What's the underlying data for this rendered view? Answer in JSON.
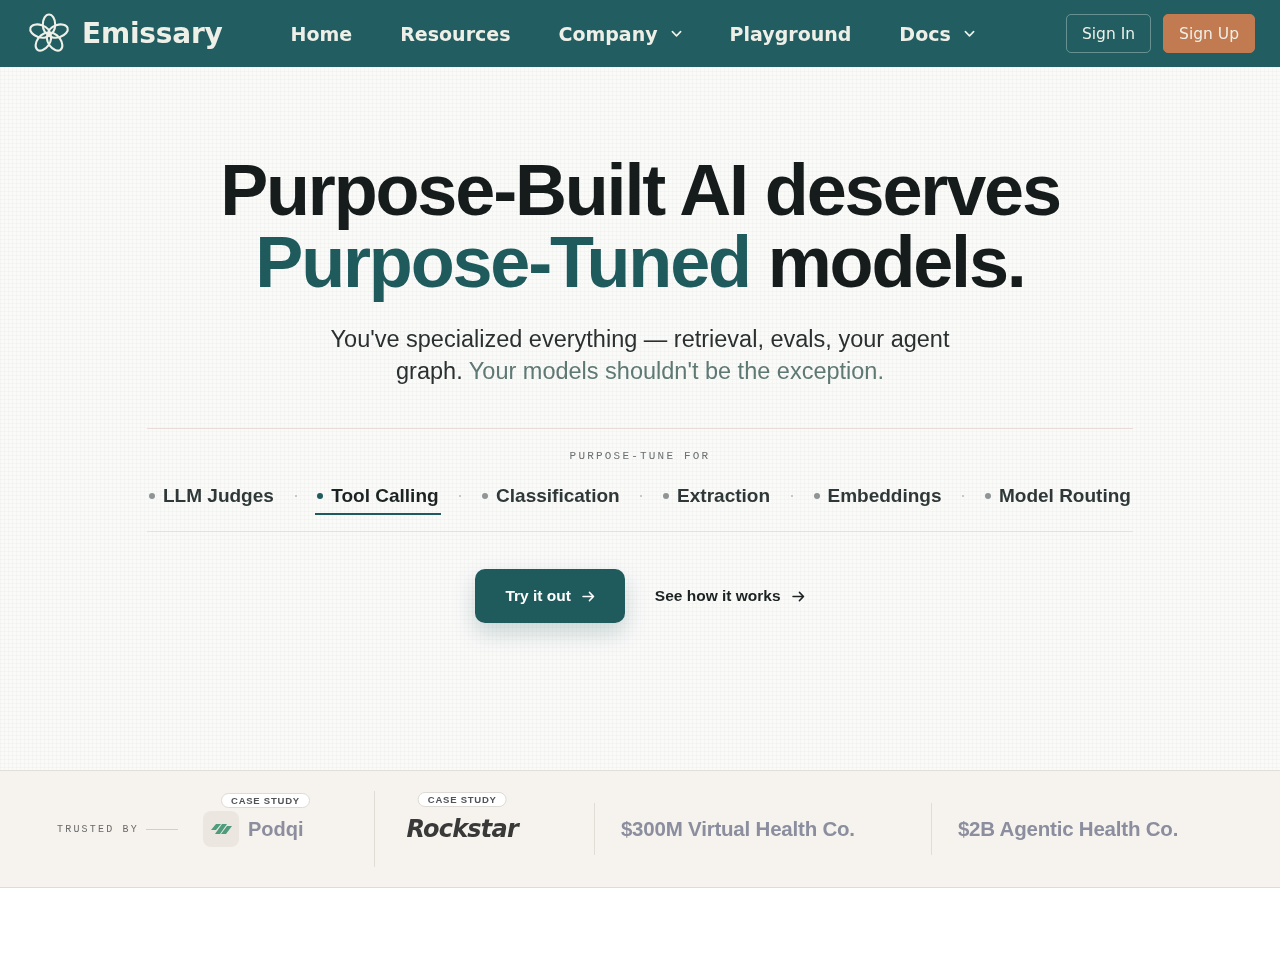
{
  "nav": {
    "brand": "Emissary",
    "links": [
      {
        "label": "Home",
        "has_menu": false
      },
      {
        "label": "Resources",
        "has_menu": false
      },
      {
        "label": "Company",
        "has_menu": true
      },
      {
        "label": "Playground",
        "has_menu": false
      },
      {
        "label": "Docs",
        "has_menu": true
      }
    ],
    "sign_in": "Sign In",
    "sign_up": "Sign Up"
  },
  "hero": {
    "heading": [
      {
        "text": "Purpose-Built AI deserves",
        "accent": false
      },
      {
        "text": "Purpose-Tuned",
        "accent": true
      },
      {
        "text": "models.",
        "accent": false
      }
    ],
    "subtitle": [
      {
        "text": "You've specialized everything — retrieval, evals, your agent graph.",
        "muted": false
      },
      {
        "text": "Your models shouldn't be the exception.",
        "muted": true
      }
    ]
  },
  "use_cases": {
    "label": "PURPOSE-TUNE FOR",
    "items": [
      {
        "label": "LLM Judges",
        "selected": false
      },
      {
        "label": "Tool Calling",
        "selected": true
      },
      {
        "label": "Classification",
        "selected": false
      },
      {
        "label": "Extraction",
        "selected": false
      },
      {
        "label": "Embeddings",
        "selected": false
      },
      {
        "label": "Model Routing",
        "selected": false
      }
    ]
  },
  "actions": {
    "primary": "Try it out",
    "secondary": "See how it works"
  },
  "trusted": {
    "label": "TRUSTED BY",
    "logos": [
      {
        "kind": "tile",
        "name": "Podqi",
        "badge": "CASE STUDY"
      },
      {
        "kind": "script",
        "name": "Rockstar",
        "badge": "CASE STUDY"
      },
      {
        "kind": "text",
        "name": "$300M Virtual Health Co."
      },
      {
        "kind": "text",
        "name": "$2B Agentic Health Co."
      }
    ]
  }
}
